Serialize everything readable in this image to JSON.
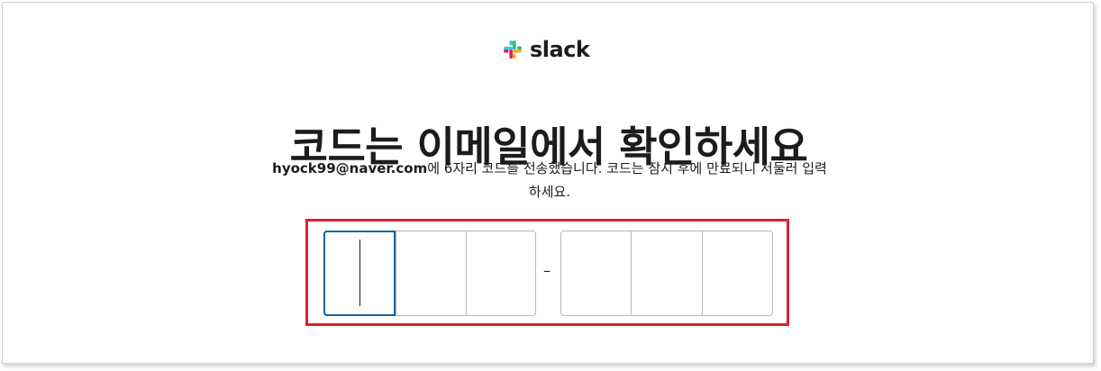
{
  "brand": {
    "logo_icon": "slack-logo-icon",
    "name": "slack",
    "colors": [
      "#36c5f0",
      "#2eb67d",
      "#ecb22e",
      "#e01e5a"
    ]
  },
  "heading": "코드는 이메일에서 확인하세요",
  "description": {
    "email": "hyock99@naver.com",
    "line1_rest": "에 6자리 코드를 전송했습니다. 코드는 잠시 후에 만료되니 서둘러 입력",
    "line2": "하세요."
  },
  "code_input": {
    "digits_first": [
      "",
      "",
      ""
    ],
    "digits_second": [
      "",
      "",
      ""
    ],
    "separator": "–",
    "highlight_color": "#e01e2b",
    "focus_color": "#1264a3"
  }
}
